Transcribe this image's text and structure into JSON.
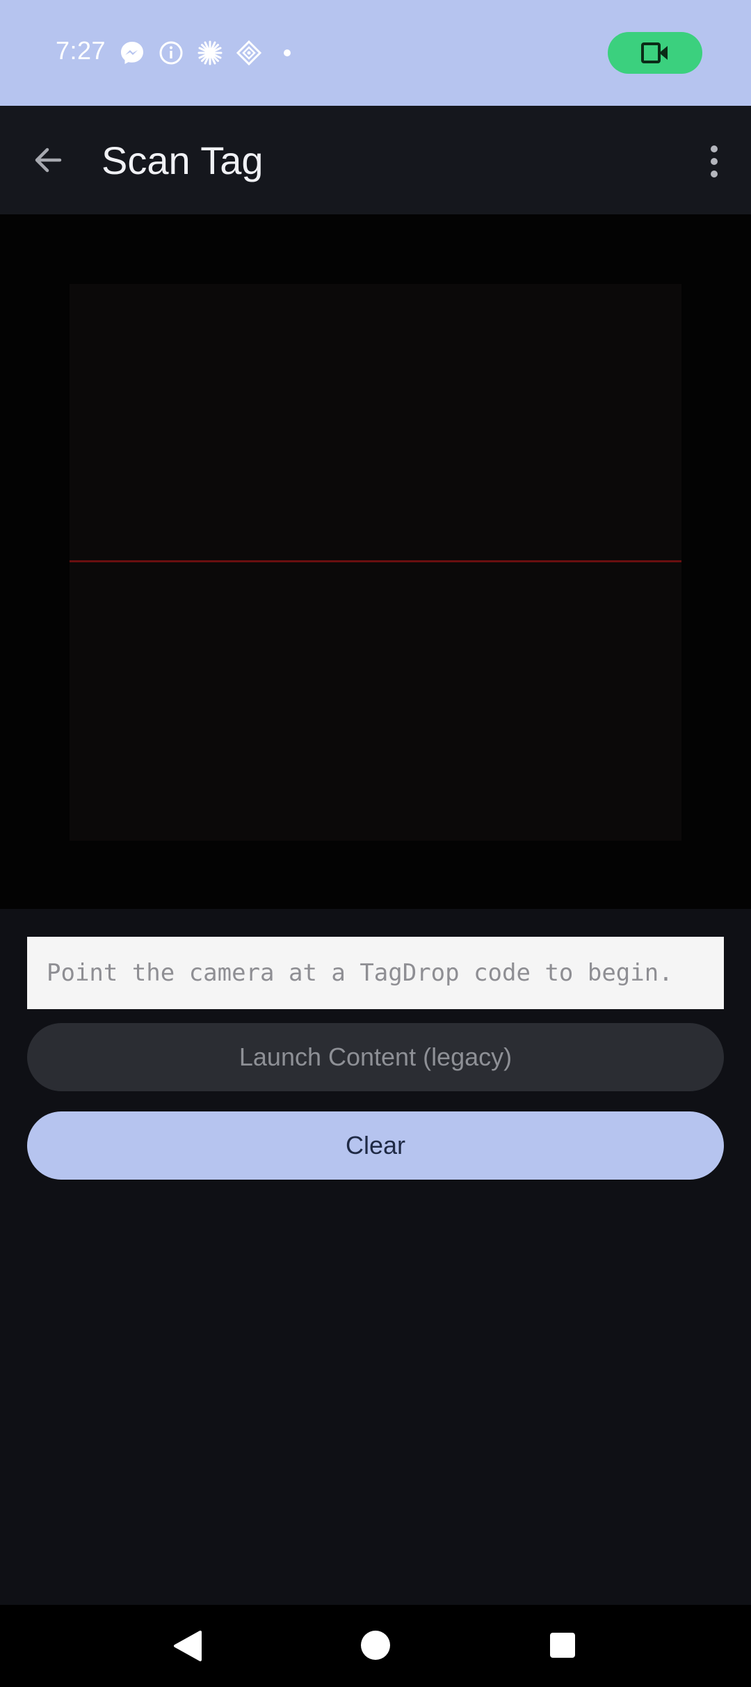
{
  "status_bar": {
    "time": "7:27",
    "icons": [
      "messenger-icon",
      "info-icon",
      "asterisk-icon",
      "diamond-icon",
      "dot-icon"
    ],
    "camera_indicator": "video-camera-icon"
  },
  "app_bar": {
    "title": "Scan Tag",
    "back_icon": "arrow-back-icon",
    "menu_icon": "more-vertical-icon"
  },
  "scanner": {
    "hint": "Point the camera at a TagDrop code to begin."
  },
  "buttons": {
    "launch_label": "Launch Content (legacy)",
    "clear_label": "Clear"
  },
  "colors": {
    "status_bar": "#b6c4ef",
    "accent": "#b6c4ef",
    "camera_pill": "#3bd07e",
    "laser": "#6a0f10",
    "background": "#0f1015"
  },
  "nav_bar": {
    "icons": [
      "nav-back-icon",
      "nav-home-icon",
      "nav-recents-icon"
    ]
  }
}
